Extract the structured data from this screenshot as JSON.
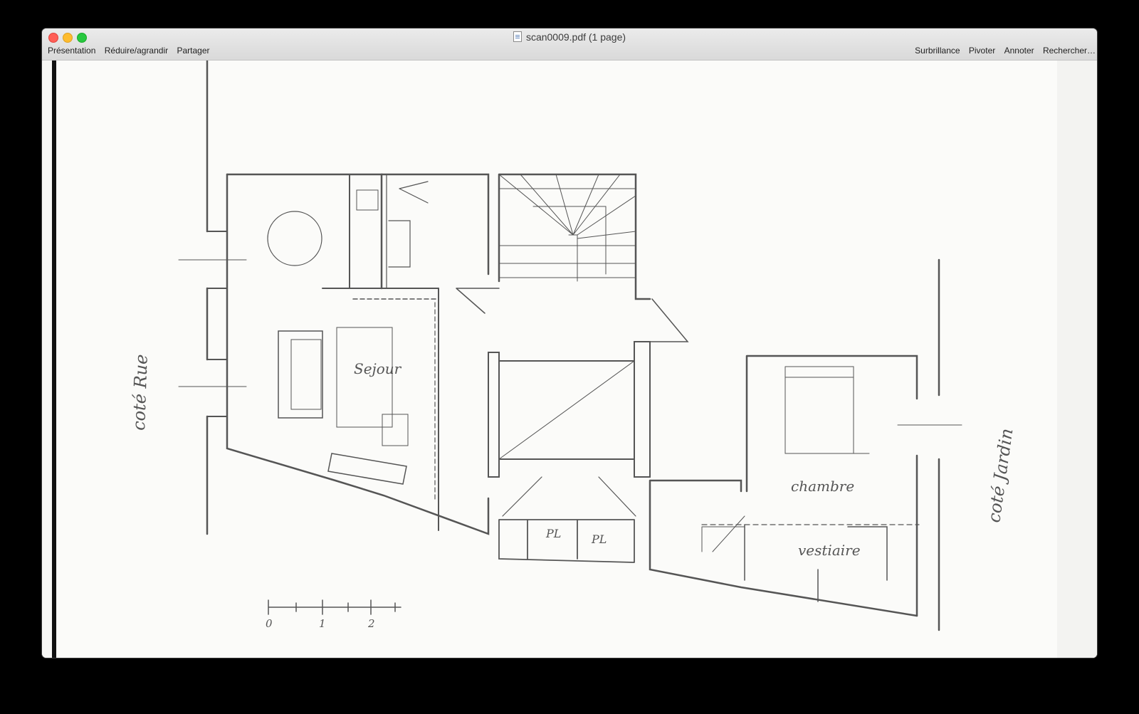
{
  "window": {
    "title": "scan0009.pdf (1 page)"
  },
  "toolbar": {
    "left": [
      "Présentation",
      "Réduire/agrandir",
      "Partager"
    ],
    "right": [
      "Surbrillance",
      "Pivoter",
      "Annoter",
      "Rechercher…"
    ]
  },
  "plan": {
    "labels": {
      "sejour": "Sejour",
      "chambre": "chambre",
      "vestiaire": "vestiaire",
      "pl1": "PL",
      "pl2": "PL",
      "cote_rue": "coté Rue",
      "cote_jardin": "coté Jardin"
    },
    "scale": [
      "0",
      "1",
      "2"
    ]
  }
}
